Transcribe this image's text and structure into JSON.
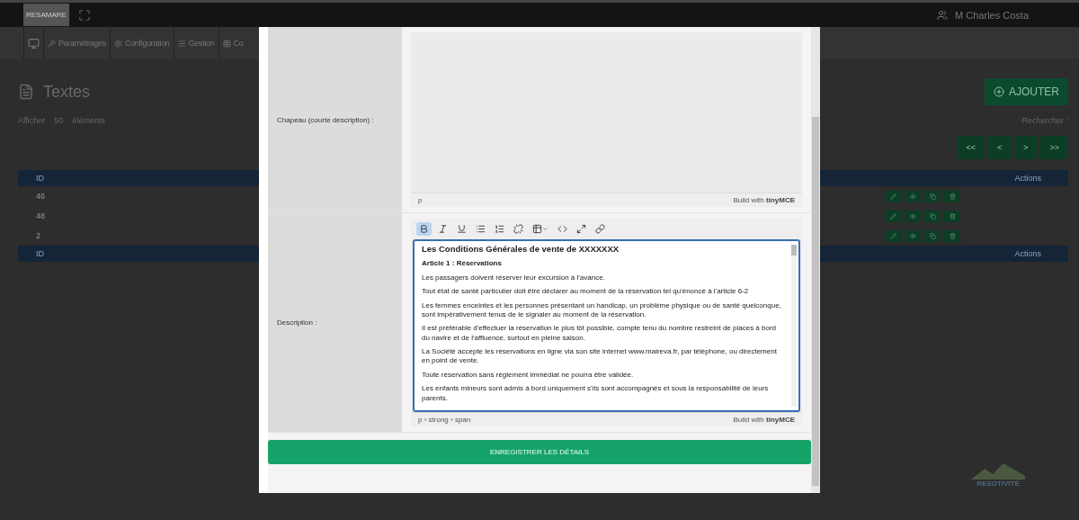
{
  "topbar": {
    "logo": "RESAMARE",
    "user": "M Charles Costa"
  },
  "nav": [
    "Paramétrages",
    "Configuration",
    "Gestion",
    "Co"
  ],
  "page": {
    "title": "Textes",
    "add_button": "AJOUTER",
    "show_label": "Afficher",
    "show_value": "50",
    "show_suffix": "éléments",
    "search_label": "Rechercher :",
    "pager": [
      "<<",
      "<",
      ">",
      ">>"
    ],
    "table": {
      "header": [
        "ID",
        "Actions"
      ],
      "rows": [
        "46",
        "48",
        "2"
      ],
      "footer": [
        "ID",
        "Actions"
      ]
    }
  },
  "modal": {
    "fields": [
      {
        "kind": "plain",
        "label": "Chapeau (courte description) :",
        "path": "p",
        "branding": "Build with",
        "brand": "tinyMCE"
      },
      {
        "kind": "rich",
        "label": "Description :",
        "path": "p › strong › span",
        "branding": "Build with",
        "brand": "tinyMCE",
        "toolbar": [
          {
            "kind": "bold",
            "selected": true
          },
          {
            "kind": "italic",
            "selected": false
          },
          {
            "kind": "underline",
            "selected": false
          },
          {
            "kind": "bullets",
            "selected": false
          },
          {
            "kind": "numbers",
            "selected": false
          },
          {
            "kind": "unlink",
            "selected": false
          },
          {
            "kind": "table",
            "selected": false
          },
          {
            "kind": "code",
            "selected": false
          },
          {
            "kind": "fullscreen",
            "selected": false
          },
          {
            "kind": "link",
            "selected": false
          }
        ],
        "content": [
          {
            "kind": "heading",
            "text": "Les Conditions Générales de vente de XXXXXXX"
          },
          {
            "kind": "subheading",
            "text": "Article 1 : Réservations"
          },
          {
            "kind": "para",
            "text": "Les passagers doivent réserver leur excursion à l'avance."
          },
          {
            "kind": "para",
            "text": "Tout état de santé particulier doit être déclarer au moment de la réservation tel qu'énoncé à l'article 6-2"
          },
          {
            "kind": "para",
            "text": "Les femmes enceintes et les personnes présentant un handicap, un problème physique ou de santé quelconque, sont impérativement tenus de le signaler au moment de la réservation."
          },
          {
            "kind": "para",
            "text": "Il est préférable d'effectuer la réservation le plus tôt possible, compte tenu du nombre restreint de places à bord du navire et de l'affluence, surtout en pleine saison."
          },
          {
            "kind": "para",
            "text": "La Société accepte les réservations en ligne via son site internet www.maireva.fr, par téléphone, ou directement en point de vente."
          },
          {
            "kind": "para",
            "text": "Toute réservation sans règlement immédiat ne pourra être validée."
          },
          {
            "kind": "para",
            "text": "Les enfants mineurs sont admis à bord uniquement s'ils sont accompagnés et sous la responsabilité de leurs parents."
          }
        ]
      }
    ],
    "save_button": "ENREGISTRER LES DÉTAILS"
  },
  "brand_logo": "RESOTIVITÉ"
}
